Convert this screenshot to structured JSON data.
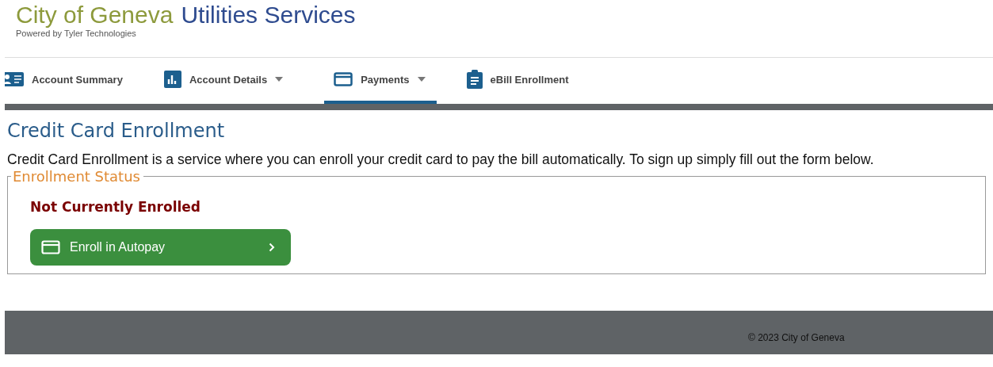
{
  "header": {
    "title_part_1": "City of Geneva",
    "title_part_2": "Utilities Services",
    "powered_by": "Powered by Tyler Technologies"
  },
  "tabs": [
    {
      "label": "Account Summary",
      "selected": false,
      "dropdown": false
    },
    {
      "label": "Account Details",
      "selected": false,
      "dropdown": true
    },
    {
      "label": "Payments",
      "selected": true,
      "dropdown": true
    },
    {
      "label": "eBill Enrollment",
      "selected": false,
      "dropdown": false
    }
  ],
  "page": {
    "title": "Credit Card Enrollment",
    "description": "Credit Card Enrollment is a service where you can enroll your credit card to pay the bill automatically. To sign up simply fill out the form below."
  },
  "enrollment_status": {
    "legend": "Enrollment Status",
    "status": "Not Currently Enrolled",
    "button": "Enroll in Autopay"
  },
  "footer": {
    "copyright": "© 2023 City of Geneva"
  }
}
